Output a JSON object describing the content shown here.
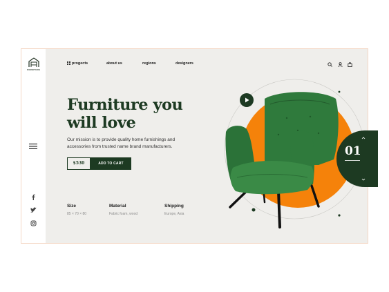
{
  "brand": {
    "logo_text": "FURNITURE"
  },
  "nav": {
    "items": [
      {
        "label": "progects",
        "icon": "grid-icon"
      },
      {
        "label": "about us"
      },
      {
        "label": "regions"
      },
      {
        "label": "designers"
      }
    ]
  },
  "toolbar": {
    "icons": [
      "search-icon",
      "user-icon",
      "bag-icon"
    ]
  },
  "hero": {
    "title_line1": "Furniture you",
    "title_line2": "will love",
    "description": "Our mission is to provide quality home furnishings and accessories from trusted name brand manufacturers.",
    "price": "$530",
    "cta_label": "ADD TO CART"
  },
  "specs": [
    {
      "title": "Size",
      "value": "85 × 70 × 80"
    },
    {
      "title": "Material",
      "value": "Fabric foam, wood"
    },
    {
      "title": "Shipping",
      "value": "Europe, Asia"
    }
  ],
  "slider": {
    "number": "01"
  },
  "social": [
    "facebook-icon",
    "twitter-icon",
    "instagram-icon"
  ],
  "colors": {
    "accent_green": "#1d3a22",
    "accent_orange": "#f5820a",
    "chair_green": "#2f7a3c",
    "background": "#efeeeb"
  }
}
